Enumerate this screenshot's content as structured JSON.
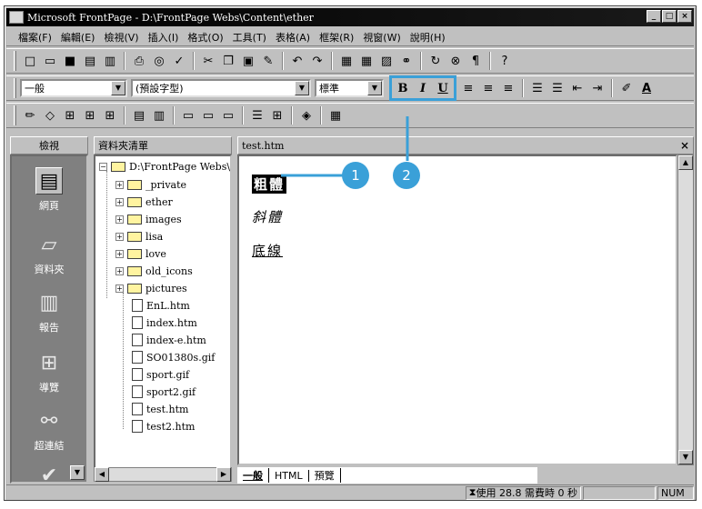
{
  "window": {
    "title": "Microsoft FrontPage - D:\\FrontPage Webs\\Content\\ether"
  },
  "menu": [
    "檔案(F)",
    "編輯(E)",
    "檢視(V)",
    "插入(I)",
    "格式(O)",
    "工具(T)",
    "表格(A)",
    "框架(R)",
    "視窗(W)",
    "說明(H)"
  ],
  "format_toolbar": {
    "style_value": "一般",
    "font_value": "(預設字型)",
    "size_value": "標準",
    "bold_label": "B",
    "italic_label": "I",
    "underline_label": "U",
    "highlight_color": "#3aa0d8"
  },
  "panes": {
    "views_header": "檢視",
    "folders_header": "資料夾清單",
    "editor_header": "test.htm"
  },
  "views": [
    {
      "label": "網頁",
      "icon": "page-icon",
      "active": true
    },
    {
      "label": "資料夾",
      "icon": "folder-icon",
      "active": false
    },
    {
      "label": "報告",
      "icon": "report-icon",
      "active": false
    },
    {
      "label": "導覽",
      "icon": "navigation-icon",
      "active": false
    },
    {
      "label": "超連結",
      "icon": "hyperlink-icon",
      "active": false
    }
  ],
  "folder_tree": {
    "root": "D:\\FrontPage Webs\\C",
    "folders": [
      "_private",
      "ether",
      "images",
      "lisa",
      "love",
      "old_icons",
      "pictures"
    ],
    "files": [
      "EnL.htm",
      "index.htm",
      "index-e.htm",
      "SO01380s.gif",
      "sport.gif",
      "sport2.gif",
      "test.htm",
      "test2.htm"
    ]
  },
  "editor": {
    "bold_line": "粗體",
    "italic_line": "斜體",
    "underline_line": "底線"
  },
  "callouts": [
    "1",
    "2"
  ],
  "tabs": [
    "一般",
    "HTML",
    "預覽"
  ],
  "status": {
    "time_text": "使用 28.8 需費時 0 秒",
    "num_indicator": "NUM"
  }
}
